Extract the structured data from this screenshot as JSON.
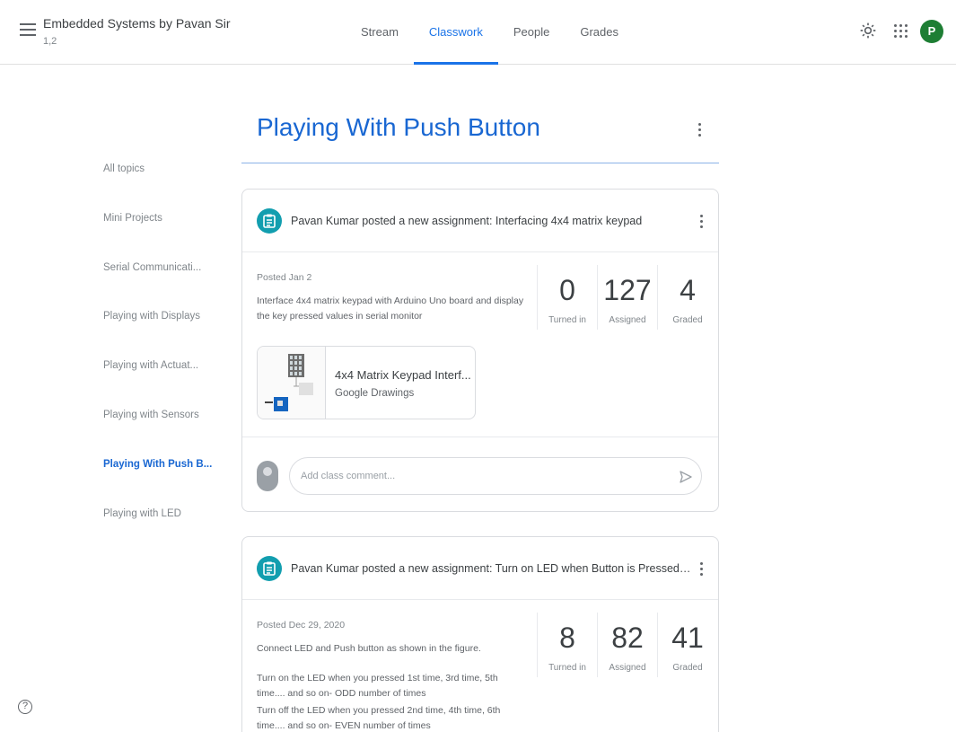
{
  "header": {
    "class_title": "Embedded Systems by Pavan Sir",
    "class_section": "1,2",
    "tabs": [
      {
        "label": "Stream"
      },
      {
        "label": "Classwork"
      },
      {
        "label": "People"
      },
      {
        "label": "Grades"
      }
    ],
    "active_tab": "Classwork",
    "avatar_letter": "P",
    "avatar_color": "#1e7e34",
    "icons": [
      "menu-icon",
      "gear-icon",
      "apps-icon"
    ]
  },
  "sidebar": {
    "items": [
      {
        "label": "All topics"
      },
      {
        "label": "Mini Projects"
      },
      {
        "label": "Serial Communicati..."
      },
      {
        "label": "Playing with Displays"
      },
      {
        "label": "Playing with Actuat..."
      },
      {
        "label": "Playing with Sensors"
      },
      {
        "label": "Playing With Push B..."
      },
      {
        "label": "Playing with LED"
      }
    ],
    "active_item": "Playing With Push B..."
  },
  "topic": {
    "title": "Playing With Push Button",
    "accent": "#1967d2"
  },
  "assignments": [
    {
      "title": "Pavan Kumar posted a new assignment: Interfacing 4x4 matrix keypad",
      "posted": "Posted Jan 2",
      "description": [
        "Interface 4x4 matrix keypad with Arduino Uno board and display the key pressed values in serial monitor"
      ],
      "stats": [
        {
          "value": "0",
          "label": "Turned in"
        },
        {
          "value": "127",
          "label": "Assigned"
        },
        {
          "value": "4",
          "label": "Graded"
        }
      ],
      "attachment": {
        "title": "4x4 Matrix Keypad Interf...",
        "type": "Google Drawings"
      },
      "comment_placeholder": "Add class comment..."
    },
    {
      "title": "Pavan Kumar posted a new assignment: Turn on LED when Button is Pressed for Odd no. of ...",
      "posted": "Posted Dec 29, 2020",
      "description": [
        "Connect LED and Push button as shown in the figure.",
        "",
        "Turn on the LED when you pressed 1st time, 3rd time, 5th time.... and so on- ODD number of times",
        "Turn off the LED when you pressed 2nd time, 4th time, 6th time.... and so on- EVEN number of times"
      ],
      "stats": [
        {
          "value": "8",
          "label": "Turned in"
        },
        {
          "value": "82",
          "label": "Assigned"
        },
        {
          "value": "41",
          "label": "Graded"
        }
      ]
    }
  ],
  "assignment_icon_color": "#129eaf",
  "help_icon_glyph": "?"
}
